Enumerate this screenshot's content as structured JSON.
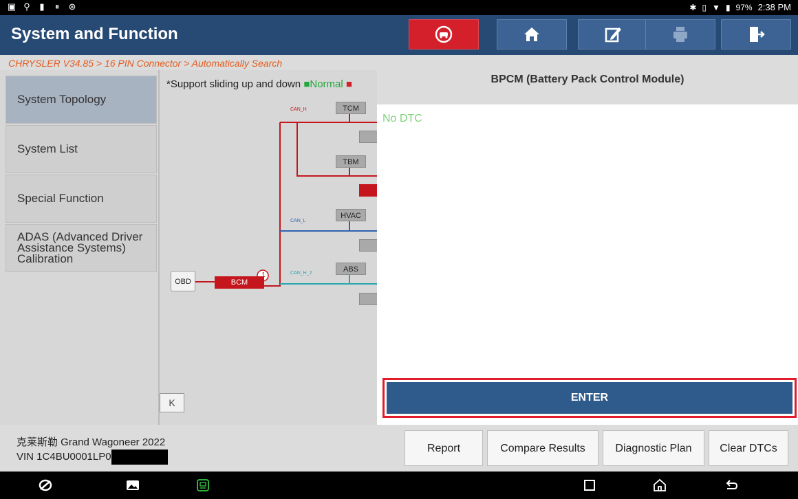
{
  "status_bar": {
    "time": "2:38 PM",
    "battery": "97%"
  },
  "header": {
    "title": "System and Function",
    "buttons": [
      {
        "name": "vehicle-icon"
      },
      {
        "name": "home-icon"
      },
      {
        "name": "edit-icon"
      },
      {
        "name": "print-icon"
      },
      {
        "name": "exit-icon"
      }
    ],
    "accent_color": "#d4202a",
    "bar_color": "#274a74"
  },
  "breadcrumb": "CHRYSLER V34.85 > 16 PIN Connector > Automatically Search",
  "sidebar": {
    "items": [
      {
        "label": "System Topology",
        "active": true
      },
      {
        "label": "System List"
      },
      {
        "label": "Special Function"
      },
      {
        "label": "ADAS (Advanced Driver Assistance Systems) Calibration"
      }
    ]
  },
  "topology": {
    "note": "*Support sliding up and down",
    "legend_normal": "■Normal",
    "legend_fault": "■",
    "modules": [
      "TCM",
      "TBM",
      "HVAC",
      "ABS",
      "OBD",
      "BCM"
    ],
    "can_labels": [
      "CAN_H",
      "CAN_L",
      "CAN_H_2"
    ],
    "badge": "1",
    "collapse_label": "K"
  },
  "detail": {
    "title": "BPCM (Battery Pack Control Module)",
    "dtc_status": "No DTC",
    "enter_label": "ENTER"
  },
  "footer": {
    "vehicle": "克莱斯勒 Grand Wagoneer 2022",
    "vin": "VIN 1C4BU0001LP0",
    "actions": [
      "Report",
      "Compare Results",
      "Diagnostic Plan",
      "Clear DTCs"
    ]
  }
}
